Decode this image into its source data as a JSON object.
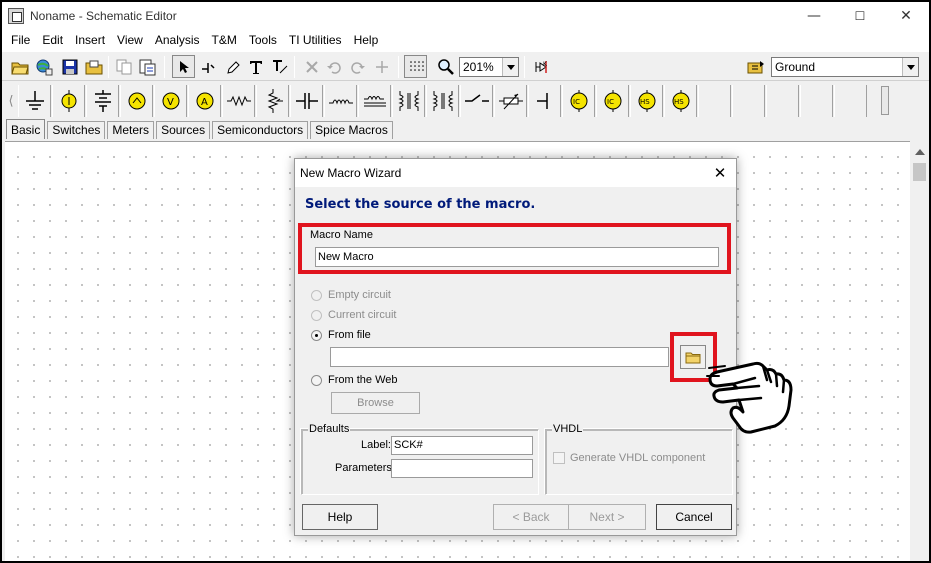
{
  "window": {
    "title": "Noname - Schematic Editor",
    "controls": {
      "minimize": "—",
      "maximize": "☐",
      "close": "✕"
    }
  },
  "menu": [
    "File",
    "Edit",
    "Insert",
    "View",
    "Analysis",
    "T&M",
    "Tools",
    "TI Utilities",
    "Help"
  ],
  "toolbar": {
    "zoom_value": "201%",
    "component_value": "Ground",
    "icons": [
      "open-folder-icon",
      "web-open-icon",
      "save-icon",
      "open-file-icon",
      "copy-icon",
      "paste-icon",
      "select-arrow-icon",
      "wire-icon",
      "pen-icon",
      "text-icon",
      "label-icon",
      "delete-icon",
      "undo-icon",
      "redo-icon",
      "pin-icon",
      "grid-icon",
      "zoom-icon",
      "analysis-icon",
      "find-component-icon"
    ]
  },
  "palette": {
    "icons": [
      "ground-icon",
      "battery-icon",
      "multi-battery-icon",
      "voltmeter-icon",
      "voltage-generator-icon",
      "ammeter-icon",
      "resistor-icon",
      "potentiometer-icon",
      "capacitor-icon",
      "inductor-icon",
      "transformer-icon",
      "coupled-inductor-icon",
      "switch-icon",
      "variable-resistor-icon",
      "jumper-icon",
      "ic-source-icon",
      "ic-source2-icon",
      "hs-source-icon",
      "hs-source2-icon"
    ],
    "tabs": [
      "Basic",
      "Switches",
      "Meters",
      "Sources",
      "Semiconductors",
      "Spice Macros"
    ],
    "active_tab": "Basic"
  },
  "dialog": {
    "title": "New Macro Wizard",
    "close": "✕",
    "heading": "Select the source of the macro.",
    "macro_name_label": "Macro Name",
    "macro_name_value": "New Macro",
    "options": {
      "empty": "Empty circuit",
      "current": "Current circuit",
      "from_file": "From file",
      "from_web": "From the Web"
    },
    "selected_option": "From file",
    "file_path_value": "",
    "browse": "Browse",
    "defaults": {
      "title": "Defaults",
      "label_label": "Label:",
      "label_value": "SCK#",
      "parameters_label": "Parameters:",
      "parameters_value": ""
    },
    "vhdl": {
      "title": "VHDL",
      "generate": "Generate VHDL component"
    },
    "buttons": {
      "help": "Help",
      "back": "< Back",
      "next": "Next >",
      "cancel": "Cancel"
    }
  },
  "colors": {
    "highlight": "#e0141e",
    "heading": "#001a7a",
    "component_yellow": "#f5e400"
  }
}
